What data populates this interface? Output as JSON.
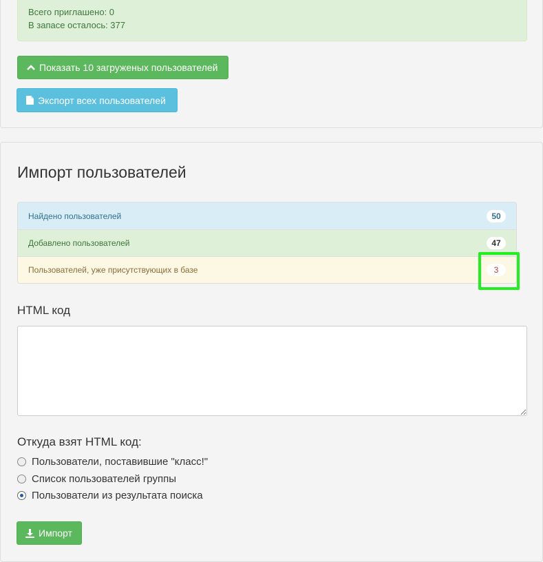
{
  "summary": {
    "invited_text": "Всего приглашено: 0",
    "remaining_text": "В запасе осталось: 377"
  },
  "buttons": {
    "show_loaded": "Показать 10 загруженых пользователей",
    "export_all": "Экспорт всех пользователей",
    "import": "Импорт"
  },
  "import_section": {
    "title": "Импорт пользователей",
    "stats": [
      {
        "label": "Найдено пользователей",
        "count": "50"
      },
      {
        "label": "Добавлено пользователей",
        "count": "47"
      },
      {
        "label": "Пользователей, уже присутствующих в базе",
        "count": "3"
      }
    ],
    "html_code_label": "HTML код",
    "html_code_value": "",
    "source_label": "Откуда взят HTML код:",
    "source_options": [
      {
        "label": "Пользователи, поставившие \"класс!\"",
        "checked": false
      },
      {
        "label": "Список пользователей группы",
        "checked": false
      },
      {
        "label": "Пользователи из результата поиска",
        "checked": true
      }
    ]
  },
  "colors": {
    "success": "#5cb85c",
    "info": "#5bc0de",
    "highlight": "#22ee22"
  },
  "icons": {
    "show_loaded": "chevron-up-icon",
    "export_all": "file-icon",
    "import": "download-icon"
  }
}
